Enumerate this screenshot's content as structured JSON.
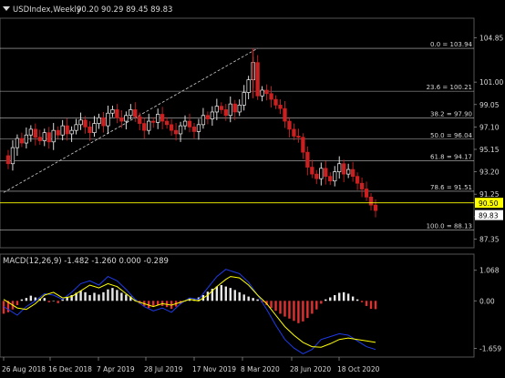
{
  "chart_data": [
    {
      "type": "candlestick",
      "title": "USDIndex,Weekly",
      "ohlc_label": "90.20 90.29 89.45 89.83",
      "price_ticks": [
        "104.85",
        "101.00",
        "99.05",
        "97.10",
        "95.15",
        "93.20",
        "91.25",
        "89.30",
        "87.35"
      ],
      "price_ylim": [
        86.75,
        106.4
      ],
      "x_labels": [
        "26 Aug 2018",
        "16 Dec 2018",
        "7 Apr 2019",
        "28 Jul 2019",
        "17 Nov 2019",
        "8 Mar 2020",
        "28 Jun 2020",
        "18 Oct 2020"
      ],
      "fib_levels": [
        {
          "label": "0.0 = 103.94",
          "value": 103.94
        },
        {
          "label": "23.6 = 100.21",
          "value": 100.21
        },
        {
          "label": "38.2 = 97.90",
          "value": 97.9
        },
        {
          "label": "50.0 = 96.04",
          "value": 96.04
        },
        {
          "label": "61.8 = 94.17",
          "value": 94.17
        },
        {
          "label": "78.6 = 91.51",
          "value": 91.51
        },
        {
          "label": "100.0 = 88.13",
          "value": 88.13
        }
      ],
      "price_marker": {
        "label": "90.50",
        "value": 90.5,
        "color": "#ffff00"
      },
      "current_price": {
        "label": "89.83",
        "value": 89.83
      },
      "candles_close_path": [
        [
          0,
          94.6
        ],
        [
          2,
          93.9
        ],
        [
          4,
          95.3
        ],
        [
          6,
          96.1
        ],
        [
          8,
          95.7
        ],
        [
          10,
          96.4
        ],
        [
          12,
          96.9
        ],
        [
          14,
          96.2
        ],
        [
          16,
          95.9
        ],
        [
          18,
          96.6
        ],
        [
          20,
          95.8
        ],
        [
          22,
          96.8
        ],
        [
          24,
          96.4
        ],
        [
          26,
          97.2
        ],
        [
          28,
          96.5
        ],
        [
          30,
          96.8
        ],
        [
          32,
          97.3
        ],
        [
          34,
          97.7
        ],
        [
          36,
          97.1
        ],
        [
          38,
          96.6
        ],
        [
          40,
          97.4
        ],
        [
          42,
          97.9
        ],
        [
          44,
          97.2
        ],
        [
          46,
          98.3
        ],
        [
          48,
          98.6
        ],
        [
          50,
          97.9
        ],
        [
          52,
          97.6
        ],
        [
          54,
          98.1
        ],
        [
          56,
          98.6
        ],
        [
          58,
          98.0
        ],
        [
          60,
          97.4
        ],
        [
          62,
          96.8
        ],
        [
          64,
          97.6
        ],
        [
          66,
          97.5
        ],
        [
          68,
          98.2
        ],
        [
          70,
          97.6
        ],
        [
          72,
          97.3
        ],
        [
          74,
          96.8
        ],
        [
          76,
          96.5
        ],
        [
          78,
          97.2
        ],
        [
          80,
          97.6
        ],
        [
          82,
          97.1
        ],
        [
          84,
          96.7
        ],
        [
          86,
          97.3
        ],
        [
          88,
          98.1
        ],
        [
          90,
          97.8
        ],
        [
          92,
          98.4
        ],
        [
          94,
          98.9
        ],
        [
          96,
          98.6
        ],
        [
          98,
          98.1
        ],
        [
          100,
          99.1
        ],
        [
          102,
          98.4
        ],
        [
          104,
          99.0
        ],
        [
          106,
          100.1
        ],
        [
          108,
          101.2
        ],
        [
          110,
          102.7
        ],
        [
          112,
          99.8
        ],
        [
          114,
          100.3
        ],
        [
          116,
          100.0
        ],
        [
          118,
          99.5
        ],
        [
          120,
          99.0
        ],
        [
          122,
          98.7
        ],
        [
          124,
          97.6
        ],
        [
          126,
          96.9
        ],
        [
          128,
          96.3
        ],
        [
          130,
          96.2
        ],
        [
          132,
          94.9
        ],
        [
          134,
          93.6
        ],
        [
          136,
          93.0
        ],
        [
          138,
          92.6
        ],
        [
          140,
          93.5
        ],
        [
          142,
          92.8
        ],
        [
          144,
          92.4
        ],
        [
          146,
          93.2
        ],
        [
          148,
          93.9
        ],
        [
          150,
          93.0
        ],
        [
          152,
          93.4
        ],
        [
          154,
          92.8
        ],
        [
          156,
          92.2
        ],
        [
          158,
          91.7
        ],
        [
          160,
          91.0
        ],
        [
          162,
          90.3
        ],
        [
          164,
          89.83
        ]
      ],
      "swing_high": 103.94,
      "trendline_label": "",
      "weeks_total": 164
    },
    {
      "type": "macd",
      "title": "MACD(12,26,9) -1.482 -1.260 0.000 -0.289",
      "y_ticks": [
        "1.068",
        "0.00",
        "-1.659"
      ],
      "ylim": [
        -1.9,
        1.25
      ],
      "histogram": [
        [
          0,
          -0.45
        ],
        [
          2,
          -0.4
        ],
        [
          4,
          -0.3
        ],
        [
          6,
          -0.15
        ],
        [
          8,
          0.05
        ],
        [
          10,
          0.1
        ],
        [
          12,
          0.18
        ],
        [
          14,
          0.12
        ],
        [
          16,
          0.08
        ],
        [
          18,
          0.1
        ],
        [
          20,
          -0.05
        ],
        [
          22,
          0.0
        ],
        [
          24,
          -0.08
        ],
        [
          26,
          0.05
        ],
        [
          28,
          0.12
        ],
        [
          30,
          0.2
        ],
        [
          32,
          0.28
        ],
        [
          34,
          0.35
        ],
        [
          36,
          0.3
        ],
        [
          38,
          0.2
        ],
        [
          40,
          0.28
        ],
        [
          42,
          0.22
        ],
        [
          44,
          0.3
        ],
        [
          46,
          0.4
        ],
        [
          48,
          0.45
        ],
        [
          50,
          0.38
        ],
        [
          52,
          0.28
        ],
        [
          54,
          0.22
        ],
        [
          56,
          0.15
        ],
        [
          58,
          0.05
        ],
        [
          60,
          -0.1
        ],
        [
          62,
          -0.18
        ],
        [
          64,
          -0.25
        ],
        [
          66,
          -0.2
        ],
        [
          68,
          -0.15
        ],
        [
          70,
          -0.18
        ],
        [
          72,
          -0.22
        ],
        [
          74,
          -0.28
        ],
        [
          76,
          -0.2
        ],
        [
          78,
          -0.12
        ],
        [
          80,
          0.0
        ],
        [
          82,
          0.08
        ],
        [
          84,
          0.05
        ],
        [
          86,
          0.12
        ],
        [
          88,
          0.2
        ],
        [
          90,
          0.32
        ],
        [
          92,
          0.42
        ],
        [
          94,
          0.5
        ],
        [
          96,
          0.55
        ],
        [
          98,
          0.5
        ],
        [
          100,
          0.45
        ],
        [
          102,
          0.38
        ],
        [
          104,
          0.3
        ],
        [
          106,
          0.22
        ],
        [
          108,
          0.15
        ],
        [
          110,
          0.1
        ],
        [
          112,
          0.05
        ],
        [
          114,
          -0.05
        ],
        [
          116,
          -0.15
        ],
        [
          118,
          -0.25
        ],
        [
          120,
          -0.35
        ],
        [
          122,
          -0.45
        ],
        [
          124,
          -0.55
        ],
        [
          126,
          -0.62
        ],
        [
          128,
          -0.7
        ],
        [
          130,
          -0.78
        ],
        [
          132,
          -0.72
        ],
        [
          134,
          -0.6
        ],
        [
          136,
          -0.45
        ],
        [
          138,
          -0.3
        ],
        [
          140,
          -0.1
        ],
        [
          142,
          0.05
        ],
        [
          144,
          0.12
        ],
        [
          146,
          0.2
        ],
        [
          148,
          0.28
        ],
        [
          150,
          0.3
        ],
        [
          152,
          0.25
        ],
        [
          154,
          0.15
        ],
        [
          156,
          0.05
        ],
        [
          158,
          -0.05
        ],
        [
          160,
          -0.18
        ],
        [
          162,
          -0.28
        ],
        [
          164,
          -0.29
        ]
      ],
      "signal_line": [
        [
          0,
          0.05
        ],
        [
          6,
          -0.25
        ],
        [
          10,
          -0.3
        ],
        [
          14,
          -0.1
        ],
        [
          18,
          0.2
        ],
        [
          22,
          0.3
        ],
        [
          26,
          0.1
        ],
        [
          30,
          0.15
        ],
        [
          34,
          0.35
        ],
        [
          38,
          0.55
        ],
        [
          42,
          0.45
        ],
        [
          46,
          0.6
        ],
        [
          50,
          0.5
        ],
        [
          54,
          0.25
        ],
        [
          58,
          0.0
        ],
        [
          62,
          -0.1
        ],
        [
          66,
          -0.2
        ],
        [
          70,
          -0.1
        ],
        [
          74,
          -0.15
        ],
        [
          78,
          -0.05
        ],
        [
          82,
          0.05
        ],
        [
          86,
          0.0
        ],
        [
          90,
          0.2
        ],
        [
          94,
          0.5
        ],
        [
          98,
          0.75
        ],
        [
          100,
          0.85
        ],
        [
          104,
          0.8
        ],
        [
          108,
          0.55
        ],
        [
          112,
          0.2
        ],
        [
          116,
          -0.1
        ],
        [
          120,
          -0.5
        ],
        [
          124,
          -0.9
        ],
        [
          128,
          -1.2
        ],
        [
          132,
          -1.45
        ],
        [
          136,
          -1.6
        ],
        [
          140,
          -1.62
        ],
        [
          144,
          -1.5
        ],
        [
          148,
          -1.35
        ],
        [
          152,
          -1.3
        ],
        [
          156,
          -1.35
        ],
        [
          160,
          -1.4
        ],
        [
          164,
          -1.45
        ]
      ],
      "macd_line": [
        [
          0,
          -0.2
        ],
        [
          6,
          -0.5
        ],
        [
          10,
          -0.2
        ],
        [
          14,
          0.0
        ],
        [
          18,
          0.25
        ],
        [
          22,
          0.2
        ],
        [
          26,
          0.05
        ],
        [
          30,
          0.3
        ],
        [
          34,
          0.6
        ],
        [
          38,
          0.7
        ],
        [
          42,
          0.55
        ],
        [
          46,
          0.85
        ],
        [
          50,
          0.7
        ],
        [
          54,
          0.4
        ],
        [
          58,
          0.05
        ],
        [
          62,
          -0.2
        ],
        [
          66,
          -0.35
        ],
        [
          70,
          -0.25
        ],
        [
          74,
          -0.4
        ],
        [
          78,
          -0.1
        ],
        [
          82,
          0.1
        ],
        [
          86,
          0.05
        ],
        [
          90,
          0.45
        ],
        [
          94,
          0.85
        ],
        [
          98,
          1.1
        ],
        [
          100,
          1.05
        ],
        [
          104,
          0.95
        ],
        [
          108,
          0.65
        ],
        [
          112,
          0.2
        ],
        [
          116,
          -0.3
        ],
        [
          120,
          -0.85
        ],
        [
          124,
          -1.35
        ],
        [
          128,
          -1.65
        ],
        [
          132,
          -1.85
        ],
        [
          136,
          -1.7
        ],
        [
          140,
          -1.35
        ],
        [
          144,
          -1.25
        ],
        [
          148,
          -1.15
        ],
        [
          152,
          -1.2
        ],
        [
          156,
          -1.4
        ],
        [
          160,
          -1.6
        ],
        [
          164,
          -1.7
        ]
      ],
      "colors": {
        "histogram_pos": "#e8e8e8",
        "histogram_neg": "#e03030",
        "signal": "#ffff00",
        "macd": "#1e3ce8"
      }
    }
  ],
  "colors": {
    "bg": "#000000",
    "grid": "#ffffff",
    "fib": "#bfbfbf",
    "bull": "#f2f2f2",
    "bear": "#cc2020",
    "axis_text": "#d8d8d8",
    "marker_bg": "#ffff00",
    "price_box_bg": "#ffffff"
  }
}
